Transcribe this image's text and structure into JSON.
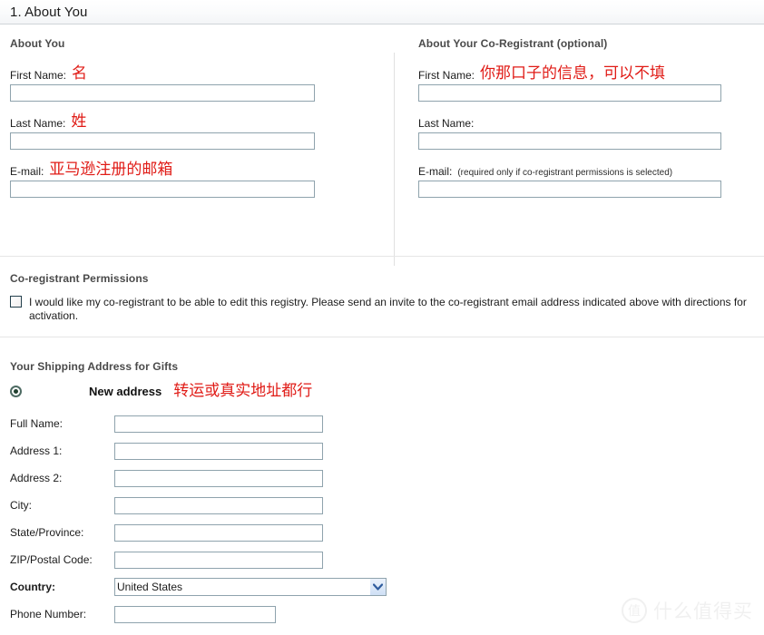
{
  "header": {
    "title": "1. About You"
  },
  "about_you": {
    "section_title": "About You",
    "fields": [
      {
        "label": "First Name:",
        "value": "",
        "note": "名"
      },
      {
        "label": "Last Name:",
        "value": "",
        "note": "姓"
      },
      {
        "label": "E-mail:",
        "value": "",
        "note": "亚马逊注册的邮箱"
      }
    ]
  },
  "co_registrant": {
    "section_title": "About Your Co-Registrant (optional)",
    "fields": [
      {
        "label": "First Name:",
        "value": "",
        "note": "你那口子的信息，可以不填",
        "hint": ""
      },
      {
        "label": "Last Name:",
        "value": "",
        "note": "",
        "hint": ""
      },
      {
        "label": "E-mail:",
        "value": "",
        "note": "",
        "hint": "(required only if co-registrant permissions is selected)"
      }
    ]
  },
  "permissions": {
    "section_title": "Co-registrant Permissions",
    "checkbox_checked": false,
    "checkbox_label": "I would like my co-registrant to be able to edit this registry. Please send an invite to the co-registrant email address indicated above with directions for activation."
  },
  "shipping": {
    "section_title": "Your Shipping Address for Gifts",
    "radio_label": "New address",
    "radio_selected": true,
    "radio_note": "转运或真实地址都行",
    "fields": [
      {
        "label": "Full Name:",
        "value": ""
      },
      {
        "label": "Address 1:",
        "value": ""
      },
      {
        "label": "Address 2:",
        "value": ""
      },
      {
        "label": "City:",
        "value": ""
      },
      {
        "label": "State/Province:",
        "value": ""
      },
      {
        "label": "ZIP/Postal Code:",
        "value": ""
      }
    ],
    "country": {
      "label": "Country:",
      "selected": "United States",
      "options": [
        "United States"
      ]
    },
    "phone": {
      "label": "Phone Number:",
      "value": ""
    }
  },
  "watermark": {
    "badge": "值",
    "text": "什么值得买"
  },
  "colors": {
    "note_red": "#e01b16",
    "input_border": "#8fa3ad",
    "section_title": "#4a4a4a",
    "header_border": "#cfd4d8"
  }
}
